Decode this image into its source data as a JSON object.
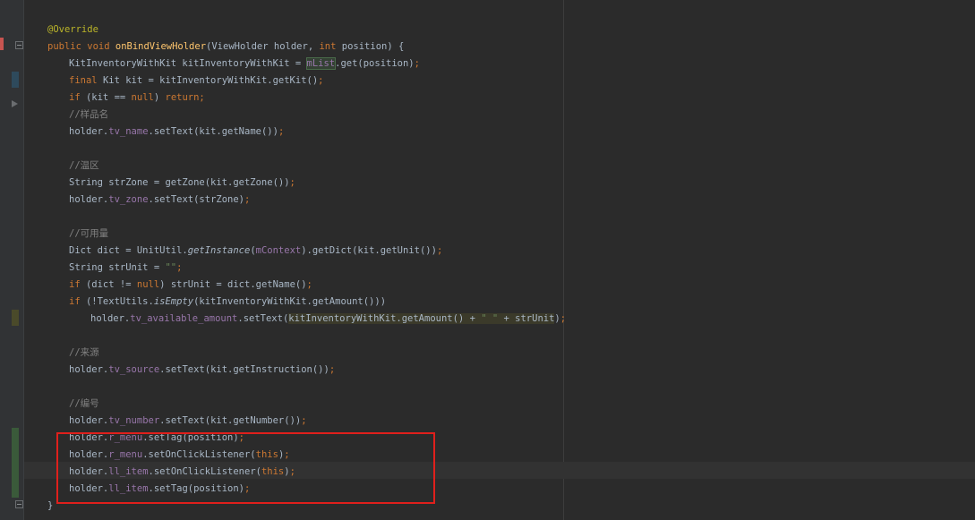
{
  "editor": {
    "lines": [
      {
        "indent": 0,
        "tokens": [
          {
            "t": "@Override",
            "c": "ann"
          }
        ]
      },
      {
        "indent": 0,
        "tokens": [
          {
            "t": "public ",
            "c": "kw"
          },
          {
            "t": "void ",
            "c": "kw"
          },
          {
            "t": "onBindViewHolder",
            "c": "fn"
          },
          {
            "t": "(ViewHolder holder, "
          },
          {
            "t": "int ",
            "c": "kw"
          },
          {
            "t": "position) {"
          }
        ]
      },
      {
        "indent": 1,
        "tokens": [
          {
            "t": "KitInventoryWithKit kitInventoryWithKit = "
          },
          {
            "t": "mList",
            "c": "mlist"
          },
          {
            "t": ".get(position)"
          },
          {
            "t": ";",
            "c": "kw"
          }
        ]
      },
      {
        "indent": 1,
        "tokens": [
          {
            "t": "final ",
            "c": "kw"
          },
          {
            "t": "Kit kit = kitInventoryWithKit.getKit()"
          },
          {
            "t": ";",
            "c": "kw"
          }
        ]
      },
      {
        "indent": 1,
        "tokens": [
          {
            "t": "if ",
            "c": "kw"
          },
          {
            "t": "(kit == "
          },
          {
            "t": "null",
            "c": "kw"
          },
          {
            "t": ") "
          },
          {
            "t": "return;",
            "c": "kw"
          }
        ]
      },
      {
        "indent": 1,
        "tokens": [
          {
            "t": "//样品名",
            "c": "comment"
          }
        ]
      },
      {
        "indent": 1,
        "tokens": [
          {
            "t": "holder."
          },
          {
            "t": "tv_name",
            "c": "field"
          },
          {
            "t": ".setText(kit.getName())"
          },
          {
            "t": ";",
            "c": "kw"
          }
        ]
      },
      {
        "indent": 1,
        "tokens": []
      },
      {
        "indent": 1,
        "tokens": [
          {
            "t": "//温区",
            "c": "comment"
          }
        ]
      },
      {
        "indent": 1,
        "tokens": [
          {
            "t": "String strZone = getZone(kit.getZone())"
          },
          {
            "t": ";",
            "c": "kw"
          }
        ]
      },
      {
        "indent": 1,
        "tokens": [
          {
            "t": "holder."
          },
          {
            "t": "tv_zone",
            "c": "field"
          },
          {
            "t": ".setText(strZone)"
          },
          {
            "t": ";",
            "c": "kw"
          }
        ]
      },
      {
        "indent": 1,
        "tokens": []
      },
      {
        "indent": 1,
        "tokens": [
          {
            "t": "//可用量",
            "c": "comment"
          }
        ]
      },
      {
        "indent": 1,
        "tokens": [
          {
            "t": "Dict dict = UnitUtil."
          },
          {
            "t": "getInstance",
            "c": "static"
          },
          {
            "t": "("
          },
          {
            "t": "mContext",
            "c": "field"
          },
          {
            "t": ").getDict(kit.getUnit())"
          },
          {
            "t": ";",
            "c": "kw"
          }
        ]
      },
      {
        "indent": 1,
        "tokens": [
          {
            "t": "String strUnit = "
          },
          {
            "t": "\"\"",
            "c": "str"
          },
          {
            "t": ";",
            "c": "kw"
          }
        ]
      },
      {
        "indent": 1,
        "tokens": [
          {
            "t": "if ",
            "c": "kw"
          },
          {
            "t": "(dict != "
          },
          {
            "t": "null",
            "c": "kw"
          },
          {
            "t": ") strUnit = dict.getName()"
          },
          {
            "t": ";",
            "c": "kw"
          }
        ]
      },
      {
        "indent": 1,
        "tokens": [
          {
            "t": "if ",
            "c": "kw"
          },
          {
            "t": "(!TextUtils."
          },
          {
            "t": "isEmpty",
            "c": "static"
          },
          {
            "t": "(kitInventoryWithKit.getAmount()))"
          }
        ]
      },
      {
        "indent": 2,
        "tokens": [
          {
            "t": "holder."
          },
          {
            "t": "tv_available_amount",
            "c": "field"
          },
          {
            "t": ".setText("
          },
          {
            "t": "kitInventoryWithKit.getAmount() + ",
            "c": "warn"
          },
          {
            "t": "\" \"",
            "c": "str warn"
          },
          {
            "t": " + strUnit",
            "c": "warn"
          },
          {
            "t": ")"
          },
          {
            "t": ";",
            "c": "kw"
          }
        ]
      },
      {
        "indent": 1,
        "tokens": []
      },
      {
        "indent": 1,
        "tokens": [
          {
            "t": "//来源",
            "c": "comment"
          }
        ]
      },
      {
        "indent": 1,
        "tokens": [
          {
            "t": "holder."
          },
          {
            "t": "tv_source",
            "c": "field"
          },
          {
            "t": ".setText(kit.getInstruction())"
          },
          {
            "t": ";",
            "c": "kw"
          }
        ]
      },
      {
        "indent": 1,
        "tokens": []
      },
      {
        "indent": 1,
        "tokens": [
          {
            "t": "//编号",
            "c": "comment"
          }
        ]
      },
      {
        "indent": 1,
        "tokens": [
          {
            "t": "holder."
          },
          {
            "t": "tv_number",
            "c": "field"
          },
          {
            "t": ".setText(kit.getNumber())"
          },
          {
            "t": ";",
            "c": "kw"
          }
        ]
      },
      {
        "indent": 1,
        "tokens": [
          {
            "t": "holder."
          },
          {
            "t": "r_menu",
            "c": "field"
          },
          {
            "t": ".setTag(position)"
          },
          {
            "t": ";",
            "c": "kw"
          }
        ]
      },
      {
        "indent": 1,
        "tokens": [
          {
            "t": "holder."
          },
          {
            "t": "r_menu",
            "c": "field"
          },
          {
            "t": ".setOnClickListener("
          },
          {
            "t": "this",
            "c": "kw"
          },
          {
            "t": ")"
          },
          {
            "t": ";",
            "c": "kw"
          }
        ]
      },
      {
        "indent": 1,
        "tokens": [
          {
            "t": "holder."
          },
          {
            "t": "ll_item",
            "c": "field"
          },
          {
            "t": ".setOnClickListener("
          },
          {
            "t": "this",
            "c": "kw"
          },
          {
            "t": ")"
          },
          {
            "t": ";",
            "c": "kw"
          }
        ]
      },
      {
        "indent": 1,
        "tokens": [
          {
            "t": "holder."
          },
          {
            "t": "ll_item",
            "c": "field"
          },
          {
            "t": ".setTag(position)"
          },
          {
            "t": ";",
            "c": "kw"
          }
        ]
      },
      {
        "indent": 0,
        "tokens": [
          {
            "t": "}"
          }
        ]
      }
    ]
  },
  "colors": {
    "background": "#2b2b2b",
    "gutter": "#313335",
    "keyword": "#cc7832",
    "annotation": "#bbb529",
    "method": "#ffc66d",
    "field": "#9876aa",
    "string": "#6a8759",
    "comment": "#808080",
    "highlight_box": "#e0201c"
  }
}
